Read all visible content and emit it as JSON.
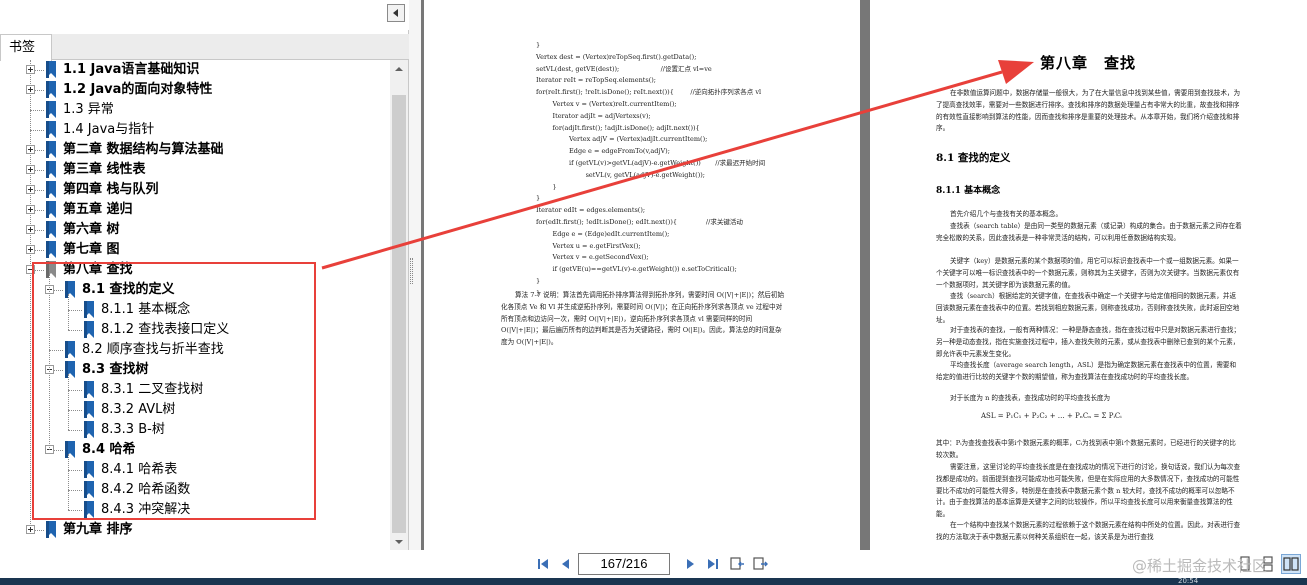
{
  "bookmarks_tab": {
    "label": "书签"
  },
  "tree": [
    {
      "label": "1.1 Java语言基础知识",
      "bold": true,
      "level": 0,
      "expandable": true
    },
    {
      "label": "1.2 Java的面向对象特性",
      "bold": true,
      "level": 0,
      "expandable": true
    },
    {
      "label": "1.3 异常",
      "bold": false,
      "level": 0,
      "expandable": false
    },
    {
      "label": "1.4 Java与指针",
      "bold": false,
      "level": 0,
      "expandable": false
    },
    {
      "label": "第二章 数据结构与算法基础",
      "bold": true,
      "level": 0,
      "expandable": true
    },
    {
      "label": "第三章 线性表",
      "bold": true,
      "level": 0,
      "expandable": true
    },
    {
      "label": "第四章 栈与队列",
      "bold": true,
      "level": 0,
      "expandable": true
    },
    {
      "label": "第五章 递归",
      "bold": true,
      "level": 0,
      "expandable": true
    },
    {
      "label": "第六章 树",
      "bold": true,
      "level": 0,
      "expandable": true
    },
    {
      "label": "第七章 图",
      "bold": true,
      "level": 0,
      "expandable": true
    },
    {
      "label": "第八章 查找",
      "bold": true,
      "level": 0,
      "expandable": true,
      "expanded": true,
      "selected": true
    },
    {
      "label": "8.1 查找的定义",
      "bold": true,
      "level": 1,
      "expandable": true,
      "expanded": true
    },
    {
      "label": "8.1.1 基本概念",
      "bold": false,
      "level": 2,
      "expandable": false
    },
    {
      "label": "8.1.2 查找表接口定义",
      "bold": false,
      "level": 2,
      "expandable": false
    },
    {
      "label": "8.2 顺序查找与折半查找",
      "bold": false,
      "level": 1,
      "expandable": false
    },
    {
      "label": "8.3 查找树",
      "bold": true,
      "level": 1,
      "expandable": true,
      "expanded": true
    },
    {
      "label": "8.3.1 二叉查找树",
      "bold": false,
      "level": 2,
      "expandable": false
    },
    {
      "label": "8.3.2 AVL树",
      "bold": false,
      "level": 2,
      "expandable": false
    },
    {
      "label": "8.3.3 B-树",
      "bold": false,
      "level": 2,
      "expandable": false
    },
    {
      "label": "8.4 哈希",
      "bold": true,
      "level": 1,
      "expandable": true,
      "expanded": true
    },
    {
      "label": "8.4.1 哈希表",
      "bold": false,
      "level": 2,
      "expandable": false
    },
    {
      "label": "8.4.2 哈希函数",
      "bold": false,
      "level": 2,
      "expandable": false
    },
    {
      "label": "8.4.3 冲突解决",
      "bold": false,
      "level": 2,
      "expandable": false
    },
    {
      "label": "第九章 排序",
      "bold": true,
      "level": 0,
      "expandable": true
    }
  ],
  "left_page": {
    "code": "}\nVertex dest = (Vertex)reTopSeq.first().getData();\nsetVL(dest, getVE(dest));                    //设置汇点 vl=ve\nIterator reIt = reTopSeq.elements();\nfor(reIt.first(); !reIt.isDone(); reIt.next()){        //逆向拓扑序列求各点 vl\n        Vertex v = (Vertex)reIt.currentItem();\n        Iterator adjIt = adjVertexs(v);\n        for(adjIt.first(); !adjIt.isDone(); adjIt.next()){\n                Vertex adjV = (Vertex)adjIt.currentItem();\n                Edge e = edgeFromTo(v,adjV);\n                if (getVL(v)>getVL(adjV)-e.getWeight())       //求最迟开始时间\n                        setVL(v, getVL(adjV)-e.getWeight());\n        }\n}\nIterator edIt = edges.elements();\nfor(edIt.first(); !edIt.isDone(); edIt.next()){              //求关键活动\n        Edge e = (Edge)edIt.currentItem();\n        Vertex u = e.getFirstVex();\n        Vertex v = e.getSecondVex();\n        if (getVE(u)==getVL(v)-e.getWeight()) e.setToCritical();\n}\n}",
    "paragraph": "算法 7-7 说明：算法首先调用拓扑排序算法得到拓扑序列，需要时间 O(|V|+|E|)；然后初始化各顶点 Ve 和 Vl 并生成逆拓扑序列，需要时间 O(|V|)；在正向拓扑序列求各顶点 ve 过程中对所有顶点和边访问一次，需时 O(|V|+|E|)，逆向拓扑序列求各顶点 vl 需要同样的时间 O(|V|+|E|)；最后遍历所有的边判断其是否为关键路径，需时 O(|E|)。因此，算法总的时间复杂度为 O(|V|+|E|)。"
  },
  "right_page": {
    "chapter_title": "第八章　查找",
    "intro": "在非数值运算问题中，数据存储量一般很大，为了在大量信息中找到某些值，需要用到查找技术，为了提高查找效率，需要对一些数据进行排序。查找和排序的数据处理量占有非常大的比重，故查找和排序的有效性直接影响到算法的性能，因而查找和排序是重要的处理技术。从本章开始，我们将介绍查找和排序。",
    "section_81": "8.1  查找的定义",
    "section_811": "8.1.1  基本概念",
    "body_1": "首先介绍几个与查找有关的基本概念。",
    "body_2": "查找表（search table）是由同一类型的数据元素（或记录）构成的集合。由于数据元素之间存在着完全松散的关系，因此查找表是一种非常灵活的结构，可以利用任意数据结构实现。",
    "body_3": "关键字（key）是数据元素的某个数据项的值，用它可以标识查找表中一个或一组数据元素。如果一个关键字可以唯一标识查找表中的一个数据元素，则称其为主关键字，否则为次关键字。当数据元素仅有一个数据项时，其关键字即为该数据元素的值。",
    "body_4": "查找（search）根据给定的关键字值，在查找表中确定一个关键字与给定值相同的数据元素，并返回该数据元素在查找表中的位置。若找到相应数据元素，则称查找成功，否则称查找失败，此时返回空地址。",
    "body_5": "对于查找表的查找，一般有两种情况：一种是静态查找，指在查找过程中只是对数据元素进行查找；另一种是动态查找，指在实施查找过程中，插入查找失败的元素，或从查找表中删除已查到的某个元素，即允许表中元素发生变化。",
    "body_6": "平均查找长度（average search length，ASL）是指为确定数据元素在查找表中的位置，需要和给定的值进行比较的关键字个数的期望值，称为查找算法在查找成功时的平均查找长度。",
    "body_7": "对于长度为 n 的查找表，查找成功时的平均查找长度为",
    "formula": "ASL = P₁C₁ + P₂C₂ + … + PₙCₙ = Σ PᵢCᵢ",
    "body_8": "其中：Pᵢ为查找查找表中第i个数据元素的概率，Cᵢ为找到表中第i个数据元素时，已经进行的关键字的比较次数。",
    "body_9": "需要注意，这里讨论的平均查找长度是在查找成功的情况下进行的讨论，换句话说，我们认为每次查找都是成功的。前面提到查找可能成功也可能失败，但是在实际应用的大多数情况下，查找成功的可能性要比不成功的可能性大得多，特别是在查找表中数据元素个数 n 较大时，查找不成功的概率可以忽略不计。由于查找算法的基本运算是关键字之间的比较操作，所以平均查找长度可以用来衡量查找算法的性能。",
    "body_10": "在一个结构中查找某个数据元素的过程依赖于这个数据元素在结构中所处的位置。因此，对表进行查找的方法取决于表中数据元素以何种关系组织在一起，该关系是为进行查找"
  },
  "bottom_bar": {
    "page_value": "167/216"
  },
  "watermark": {
    "text": "@稀土掘金技术社区"
  },
  "taskbar": {
    "clock": "20:54"
  },
  "colors": {
    "highlight": "#e8403a",
    "arrow": "#e8403a",
    "doc_background": "#777777"
  }
}
